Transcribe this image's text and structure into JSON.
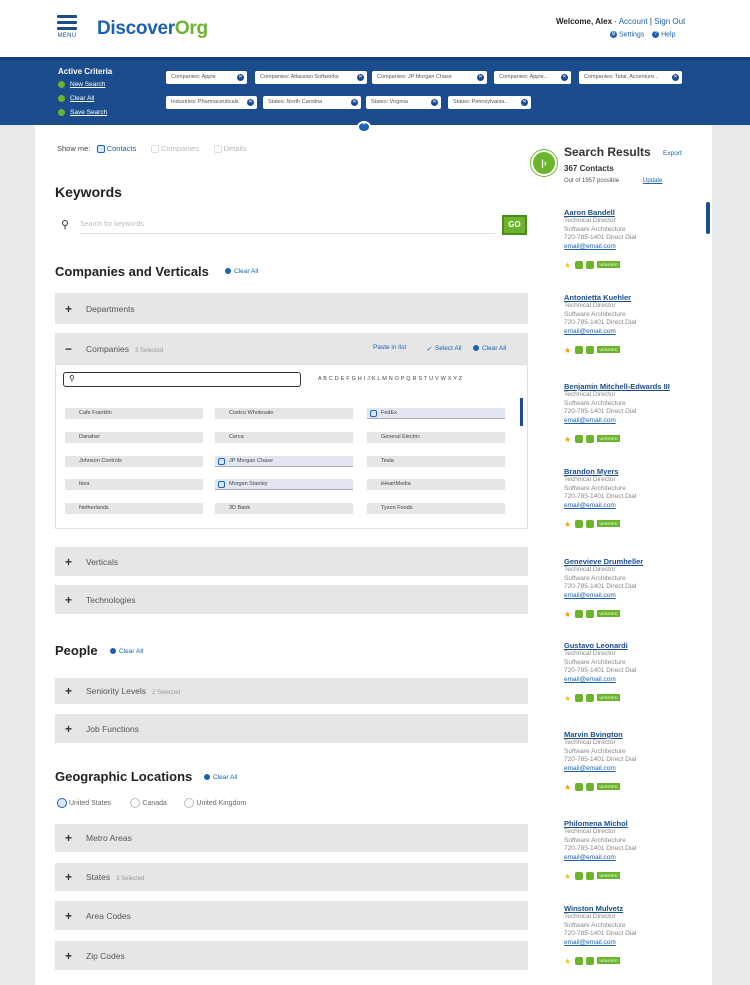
{
  "header": {
    "menu_label": "MENU",
    "logo_part1": "Discover",
    "logo_part2": "Org",
    "welcome": "Welcome, Alex",
    "account_link": "Account",
    "sign_out": "Sign Out",
    "settings": "Settings",
    "help": "Help"
  },
  "criteria": {
    "title": "Active Criteria",
    "links": [
      "New Search",
      "Clear All",
      "Save Search"
    ],
    "chips": [
      "Companies: Apple",
      "Companies: Atlassian Softworks",
      "Companies: JP Morgan Chase",
      "Companies: Apple...",
      "Companies: Tidal, Accenture...",
      "Industries: Pharmaceuticals",
      "States: North Carolina",
      "States: Virginia",
      "States: Pennsylvania..."
    ]
  },
  "show_me": {
    "label": "Show me:",
    "options": [
      "Contacts",
      "Companies",
      "Details"
    ],
    "selected": "Contacts"
  },
  "keywords": {
    "title": "Keywords",
    "placeholder": "Search for keywords",
    "go_label": "GO"
  },
  "companies_verticals": {
    "title": "Companies and Verticals",
    "clear_all": "Clear All",
    "departments_label": "Departments",
    "companies_label": "Companies",
    "companies_count": "3 Selected",
    "paste_in_list": "Paste in list",
    "select_all": "Select All",
    "clear_all_companies": "Clear All",
    "alphabet": "A B C D E F G H I J K L M N O P Q R S T U V W X Y Z",
    "company_cells": [
      [
        "Cafe Franklin",
        "Costco Wholesale",
        "FedEx"
      ],
      [
        "Danaher",
        "Cerca",
        "General Electric"
      ],
      [
        "Johnson Controls",
        "JP Morgan Chase",
        "Tesla"
      ],
      [
        "Ikea",
        "Morgan Stanley",
        "iHeartMedia"
      ],
      [
        "Netherlands",
        "3D Bank",
        "Tyson Foods"
      ]
    ],
    "selected_cells": [
      "FedEx",
      "JP Morgan Chase",
      "Morgan Stanley"
    ],
    "verticals_label": "Verticals",
    "technologies_label": "Technologies"
  },
  "people": {
    "title": "People",
    "clear_all": "Clear All",
    "seniority_label": "Seniority Levels",
    "seniority_count": "2 Selected",
    "functions_label": "Job Functions"
  },
  "geo": {
    "title": "Geographic Locations",
    "clear_all": "Clear All",
    "countries": [
      "United States",
      "Canada",
      "United Kingdom"
    ],
    "selected_country": "United States",
    "metro_label": "Metro Areas",
    "states_label": "States",
    "states_count": "3 Selected",
    "area_codes_label": "Area Codes",
    "zip_label": "Zip Codes"
  },
  "results": {
    "title": "Search Results",
    "export": "Export",
    "count": "367 Contacts",
    "out_of": "Out of 1957 possible",
    "update": "Update",
    "items": [
      {
        "name": "Aaron Bandell",
        "title": "Technical Director",
        "dept": "Software Architecture",
        "phone": "720-785-1401 Direct Dial",
        "email": "email@email.com"
      },
      {
        "name": "Antonietta Kuehler",
        "title": "Technical Director",
        "dept": "Software Architecture",
        "phone": "720-785-1401 Direct Dial",
        "email": "email@email.com"
      },
      {
        "name": "Benjamin Mitchell-Edwards III",
        "title": "Technical Director",
        "dept": "Software Architecture",
        "phone": "720-785-1401 Direct Dial",
        "email": "email@email.com"
      },
      {
        "name": "Brandon Myers",
        "title": "Technical Director",
        "dept": "Software Architecture",
        "phone": "720-785-1401 Direct Dial",
        "email": "email@email.com"
      },
      {
        "name": "Genevieve Drumheller",
        "title": "Technical Director",
        "dept": "Software Architecture",
        "phone": "720-785-1401 Direct Dial",
        "email": "email@email.com"
      },
      {
        "name": "Gustavo Leonardi",
        "title": "Technical Director",
        "dept": "Software Architecture",
        "phone": "720-785-1401 Direct Dial",
        "email": "email@email.com"
      },
      {
        "name": "Marvin Bvington",
        "title": "Technical Director",
        "dept": "Software Architecture",
        "phone": "720-785-1401 Direct Dial",
        "email": "email@email.com"
      },
      {
        "name": "Philomena Michol",
        "title": "Technical Director",
        "dept": "Software Architecture",
        "phone": "720-785-1401 Direct Dial",
        "email": "email@email.com"
      },
      {
        "name": "Winston Mulvetz",
        "title": "Technical Director",
        "dept": "Software Architecture",
        "phone": "720-785-1401 Direct Dial",
        "email": "email@email.com"
      }
    ],
    "badge": "VERIFIED"
  },
  "colors": {
    "brand_blue": "#1b4d8e",
    "brand_green": "#6cb42c",
    "link_blue": "#1b62b3"
  }
}
